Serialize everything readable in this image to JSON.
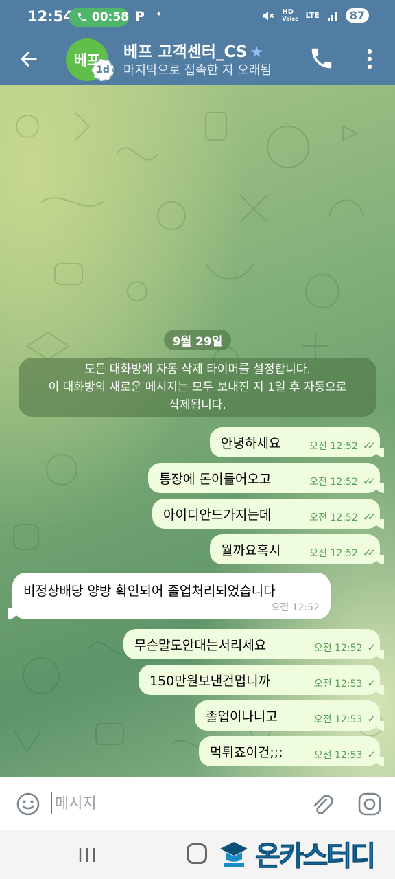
{
  "status_bar": {
    "time": "12:54",
    "call_timer": "00:58",
    "app_letter": "P",
    "dot": "•",
    "hd_label": "HD",
    "voice_label": "Voice",
    "lte_label": "LTE",
    "battery": "87"
  },
  "header": {
    "avatar_text": "베프",
    "timer_badge": "1d",
    "title": "베프 고객센터_CS",
    "subtitle": "마지막으로 접속한 지 오래됨",
    "icons": [
      "back-arrow-icon",
      "star-icon",
      "phone-icon",
      "more-vertical-icon"
    ]
  },
  "chat": {
    "date": "9월 29일",
    "service_message": [
      "모든 대화방에 자동 삭제 타이머를 설정합니다.",
      "이 대화방의 새로운 메시지는 모두 보내진 지 1일 후 자동으로",
      "삭제됩니다."
    ],
    "messages": [
      {
        "text": "안녕하세요",
        "time": "오전 12:52",
        "status": "read"
      },
      {
        "text": "통장에 돈이들어오고",
        "time": "오전 12:52",
        "status": "read"
      },
      {
        "text": "아이디안드가지는데",
        "time": "오전 12:52",
        "status": "read"
      },
      {
        "text": "뭘까요혹시",
        "time": "오전 12:52",
        "status": "read"
      },
      {
        "text": "비정상배당 양방 확인되어 졸업처리되었습니다",
        "time": "오전 12:52",
        "incoming": true
      },
      {
        "text": "무슨말도안대는서리세요",
        "time": "오전 12:52",
        "status": "sent"
      },
      {
        "text": "150만원보낸건멉니까",
        "time": "오전 12:53",
        "status": "sent"
      },
      {
        "text": "졸업이나니고",
        "time": "오전 12:53",
        "status": "sent"
      },
      {
        "text": "먹튀죠이건;;;",
        "time": "오전 12:53",
        "status": "sent"
      }
    ],
    "check_glyphs": {
      "read": "✓✓",
      "sent": "✓"
    },
    "colors": {
      "outgoing_bubble": "#effdde",
      "incoming_bubble": "#ffffff",
      "accent": "#517da2",
      "check": "#59a15a"
    }
  },
  "input": {
    "placeholder": "메시지",
    "icons": [
      "emoji-icon",
      "paperclip-icon",
      "camera-icon"
    ]
  },
  "nav": {
    "watermark": "온카스터디"
  }
}
